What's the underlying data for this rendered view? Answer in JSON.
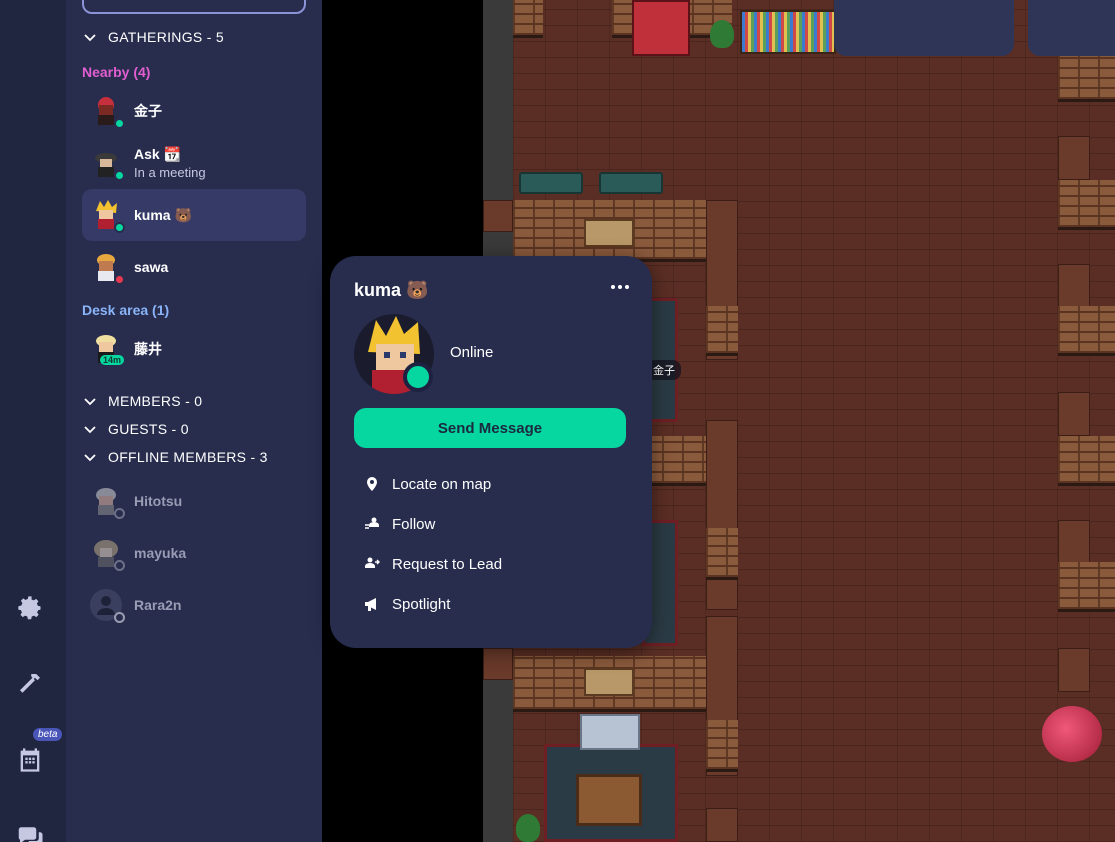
{
  "sidebar": {
    "sections": {
      "gatherings": "GATHERINGS - 5",
      "members": "MEMBERS - 0",
      "guests": "GUESTS - 0",
      "offline": "OFFLINE MEMBERS - 3"
    },
    "groups": {
      "nearby": "Nearby (4)",
      "desk_area": "Desk area (1)"
    },
    "nearby": [
      {
        "name": "金子",
        "status": "online"
      },
      {
        "name": "Ask 📆",
        "subtitle": "In a meeting",
        "status": "online"
      },
      {
        "name": "kuma 🐻",
        "status": "online",
        "selected": true
      },
      {
        "name": "sawa",
        "status": "busy"
      }
    ],
    "desk_area": [
      {
        "name": "藤井",
        "badge": "14m"
      }
    ],
    "offline_members": [
      {
        "name": "Hitotsu"
      },
      {
        "name": "mayuka"
      },
      {
        "name": "Rara2n"
      }
    ]
  },
  "rail": {
    "beta_badge": "beta",
    "icons": [
      "settings-icon",
      "build-hammer-icon",
      "calendar-icon",
      "chat-icon"
    ]
  },
  "map": {
    "name_tag": "金子"
  },
  "popup": {
    "name": "kuma 🐻",
    "status": "Online",
    "send_message": "Send Message",
    "menu": [
      {
        "label": "Locate on map",
        "icon": "location-pin-icon"
      },
      {
        "label": "Follow",
        "icon": "follow-icon"
      },
      {
        "label": "Request to Lead",
        "icon": "lead-icon"
      },
      {
        "label": "Spotlight",
        "icon": "megaphone-icon"
      }
    ]
  },
  "colors": {
    "accent_green": "#06d6a0",
    "nearby_label": "#e05ed0",
    "desk_label": "#8ab4f8",
    "panel_bg": "#282d4e"
  }
}
